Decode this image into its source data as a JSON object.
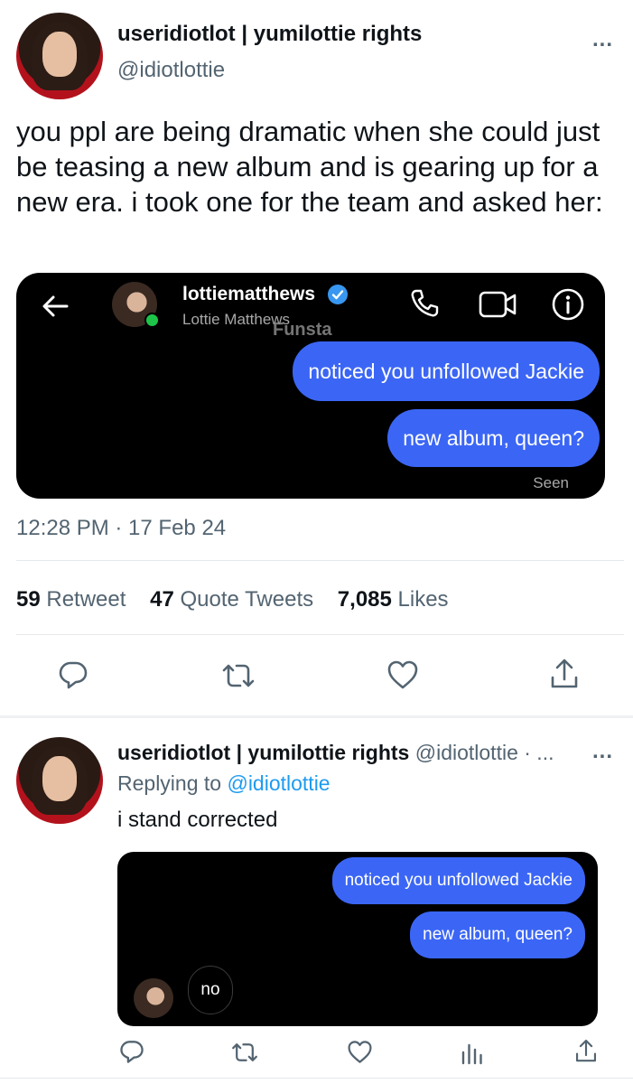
{
  "tweet": {
    "display_name": "useridiotlot | yumilottie rights",
    "handle": "@idiotlottie",
    "more": "...",
    "text": "you ppl are being dramatic when she could just be teasing a new album and is gearing up for a new era. i took one for the team and asked her:",
    "timestamp": "12:28 PM · 17 Feb 24",
    "stats": [
      {
        "count": "59",
        "label": "Retweet"
      },
      {
        "count": "47",
        "label": "Quote Tweets"
      },
      {
        "count": "7,085",
        "label": "Likes"
      }
    ]
  },
  "dm_screenshot": {
    "username": "lottiematthews",
    "full_name": "Lottie Matthews",
    "watermark": "Funsta",
    "messages": [
      "noticed you unfollowed Jackie",
      "new album, queen?"
    ],
    "seen": "Seen",
    "verified_color": "#3897f0",
    "online_color": "#1ec44a"
  },
  "reply": {
    "display_name": "useridiotlot | yumilottie rights",
    "handle_trunc": "@idiotlottie · ...",
    "replying_prefix": "Replying to",
    "replying_handle": "@idiotlottie",
    "text": "i stand corrected",
    "more": "...",
    "dm": {
      "messages": [
        "noticed you unfollowed Jackie",
        "new album, queen?"
      ],
      "reply": "no"
    }
  },
  "colors": {
    "bubble_blue": "#3b66f5",
    "text_secondary": "#536471",
    "link_blue": "#1d9bf0"
  }
}
